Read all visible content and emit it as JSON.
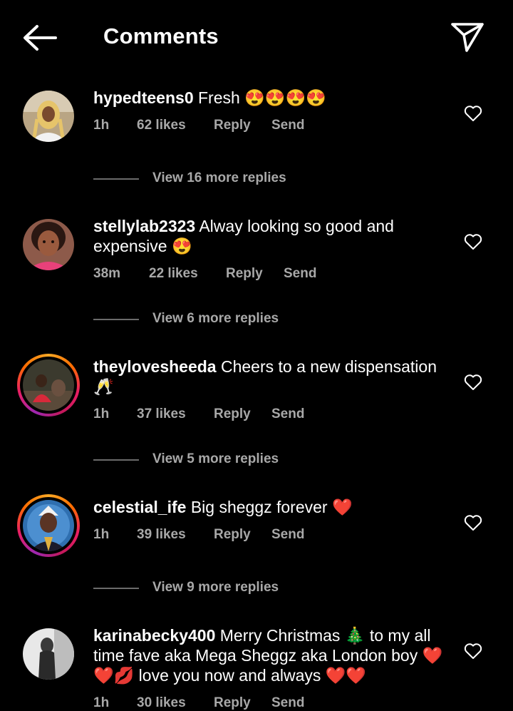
{
  "header": {
    "title": "Comments"
  },
  "comments": [
    {
      "username": "hypedteens0",
      "text": "Fresh 😍😍😍😍",
      "time": "1h",
      "likes": "62 likes",
      "reply": "Reply",
      "send": "Send",
      "view_more": "View 16 more replies"
    },
    {
      "username": "stellylab2323",
      "text": "Alway looking so good and expensive 😍",
      "time": "38m",
      "likes": "22 likes",
      "reply": "Reply",
      "send": "Send",
      "view_more": "View 6 more replies"
    },
    {
      "username": "theylovesheeda",
      "text": "Cheers to a new dispensation 🥂",
      "time": "1h",
      "likes": "37 likes",
      "reply": "Reply",
      "send": "Send",
      "view_more": "View 5 more replies"
    },
    {
      "username": "celestial_ife",
      "text": "Big sheggz forever ❤️",
      "time": "1h",
      "likes": "39 likes",
      "reply": "Reply",
      "send": "Send",
      "view_more": "View 9 more replies"
    },
    {
      "username": "karinabecky400",
      "text": "Merry Christmas 🎄 to my all time fave aka Mega Sheggz aka London boy ❤️❤️💋 love you now and always ❤️❤️",
      "time": "1h",
      "likes": "30 likes",
      "reply": "Reply",
      "send": "Send"
    }
  ]
}
